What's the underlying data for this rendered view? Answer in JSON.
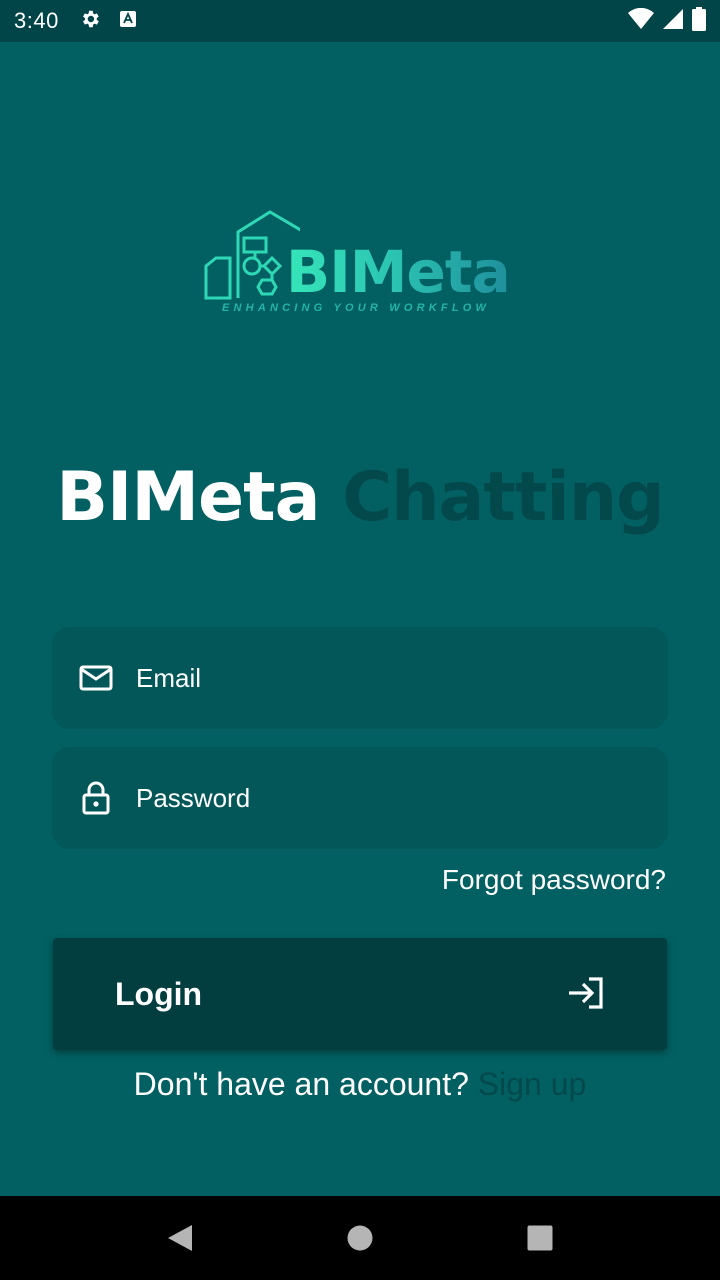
{
  "status_bar": {
    "time": "3:40",
    "icons": [
      "settings-icon",
      "a11y-icon",
      "wifi-icon",
      "signal-icon",
      "battery-icon"
    ]
  },
  "logo": {
    "word": "BIMeta",
    "tagline": "ENHANCING YOUR WORKFLOW"
  },
  "title": {
    "part1": "BIMeta",
    "part2": "Chatting"
  },
  "form": {
    "email_placeholder": "Email",
    "password_placeholder": "Password",
    "forgot_label": "Forgot password?",
    "login_label": "Login",
    "no_account_text": "Don't have an account?",
    "signup_label": "Sign up"
  },
  "colors": {
    "background": "#026062",
    "field": "#035759",
    "button": "#023d40",
    "muted_text": "#03494b"
  }
}
